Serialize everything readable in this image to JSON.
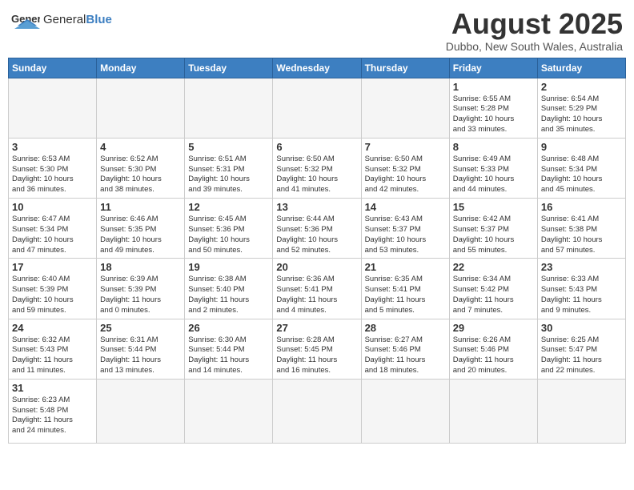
{
  "header": {
    "logo_general": "General",
    "logo_blue": "Blue",
    "title": "August 2025",
    "subtitle": "Dubbo, New South Wales, Australia"
  },
  "weekdays": [
    "Sunday",
    "Monday",
    "Tuesday",
    "Wednesday",
    "Thursday",
    "Friday",
    "Saturday"
  ],
  "weeks": [
    [
      {
        "day": "",
        "info": ""
      },
      {
        "day": "",
        "info": ""
      },
      {
        "day": "",
        "info": ""
      },
      {
        "day": "",
        "info": ""
      },
      {
        "day": "",
        "info": ""
      },
      {
        "day": "1",
        "info": "Sunrise: 6:55 AM\nSunset: 5:28 PM\nDaylight: 10 hours\nand 33 minutes."
      },
      {
        "day": "2",
        "info": "Sunrise: 6:54 AM\nSunset: 5:29 PM\nDaylight: 10 hours\nand 35 minutes."
      }
    ],
    [
      {
        "day": "3",
        "info": "Sunrise: 6:53 AM\nSunset: 5:30 PM\nDaylight: 10 hours\nand 36 minutes."
      },
      {
        "day": "4",
        "info": "Sunrise: 6:52 AM\nSunset: 5:30 PM\nDaylight: 10 hours\nand 38 minutes."
      },
      {
        "day": "5",
        "info": "Sunrise: 6:51 AM\nSunset: 5:31 PM\nDaylight: 10 hours\nand 39 minutes."
      },
      {
        "day": "6",
        "info": "Sunrise: 6:50 AM\nSunset: 5:32 PM\nDaylight: 10 hours\nand 41 minutes."
      },
      {
        "day": "7",
        "info": "Sunrise: 6:50 AM\nSunset: 5:32 PM\nDaylight: 10 hours\nand 42 minutes."
      },
      {
        "day": "8",
        "info": "Sunrise: 6:49 AM\nSunset: 5:33 PM\nDaylight: 10 hours\nand 44 minutes."
      },
      {
        "day": "9",
        "info": "Sunrise: 6:48 AM\nSunset: 5:34 PM\nDaylight: 10 hours\nand 45 minutes."
      }
    ],
    [
      {
        "day": "10",
        "info": "Sunrise: 6:47 AM\nSunset: 5:34 PM\nDaylight: 10 hours\nand 47 minutes."
      },
      {
        "day": "11",
        "info": "Sunrise: 6:46 AM\nSunset: 5:35 PM\nDaylight: 10 hours\nand 49 minutes."
      },
      {
        "day": "12",
        "info": "Sunrise: 6:45 AM\nSunset: 5:36 PM\nDaylight: 10 hours\nand 50 minutes."
      },
      {
        "day": "13",
        "info": "Sunrise: 6:44 AM\nSunset: 5:36 PM\nDaylight: 10 hours\nand 52 minutes."
      },
      {
        "day": "14",
        "info": "Sunrise: 6:43 AM\nSunset: 5:37 PM\nDaylight: 10 hours\nand 53 minutes."
      },
      {
        "day": "15",
        "info": "Sunrise: 6:42 AM\nSunset: 5:37 PM\nDaylight: 10 hours\nand 55 minutes."
      },
      {
        "day": "16",
        "info": "Sunrise: 6:41 AM\nSunset: 5:38 PM\nDaylight: 10 hours\nand 57 minutes."
      }
    ],
    [
      {
        "day": "17",
        "info": "Sunrise: 6:40 AM\nSunset: 5:39 PM\nDaylight: 10 hours\nand 59 minutes."
      },
      {
        "day": "18",
        "info": "Sunrise: 6:39 AM\nSunset: 5:39 PM\nDaylight: 11 hours\nand 0 minutes."
      },
      {
        "day": "19",
        "info": "Sunrise: 6:38 AM\nSunset: 5:40 PM\nDaylight: 11 hours\nand 2 minutes."
      },
      {
        "day": "20",
        "info": "Sunrise: 6:36 AM\nSunset: 5:41 PM\nDaylight: 11 hours\nand 4 minutes."
      },
      {
        "day": "21",
        "info": "Sunrise: 6:35 AM\nSunset: 5:41 PM\nDaylight: 11 hours\nand 5 minutes."
      },
      {
        "day": "22",
        "info": "Sunrise: 6:34 AM\nSunset: 5:42 PM\nDaylight: 11 hours\nand 7 minutes."
      },
      {
        "day": "23",
        "info": "Sunrise: 6:33 AM\nSunset: 5:43 PM\nDaylight: 11 hours\nand 9 minutes."
      }
    ],
    [
      {
        "day": "24",
        "info": "Sunrise: 6:32 AM\nSunset: 5:43 PM\nDaylight: 11 hours\nand 11 minutes."
      },
      {
        "day": "25",
        "info": "Sunrise: 6:31 AM\nSunset: 5:44 PM\nDaylight: 11 hours\nand 13 minutes."
      },
      {
        "day": "26",
        "info": "Sunrise: 6:30 AM\nSunset: 5:44 PM\nDaylight: 11 hours\nand 14 minutes."
      },
      {
        "day": "27",
        "info": "Sunrise: 6:28 AM\nSunset: 5:45 PM\nDaylight: 11 hours\nand 16 minutes."
      },
      {
        "day": "28",
        "info": "Sunrise: 6:27 AM\nSunset: 5:46 PM\nDaylight: 11 hours\nand 18 minutes."
      },
      {
        "day": "29",
        "info": "Sunrise: 6:26 AM\nSunset: 5:46 PM\nDaylight: 11 hours\nand 20 minutes."
      },
      {
        "day": "30",
        "info": "Sunrise: 6:25 AM\nSunset: 5:47 PM\nDaylight: 11 hours\nand 22 minutes."
      }
    ],
    [
      {
        "day": "31",
        "info": "Sunrise: 6:23 AM\nSunset: 5:48 PM\nDaylight: 11 hours\nand 24 minutes."
      },
      {
        "day": "",
        "info": ""
      },
      {
        "day": "",
        "info": ""
      },
      {
        "day": "",
        "info": ""
      },
      {
        "day": "",
        "info": ""
      },
      {
        "day": "",
        "info": ""
      },
      {
        "day": "",
        "info": ""
      }
    ]
  ]
}
